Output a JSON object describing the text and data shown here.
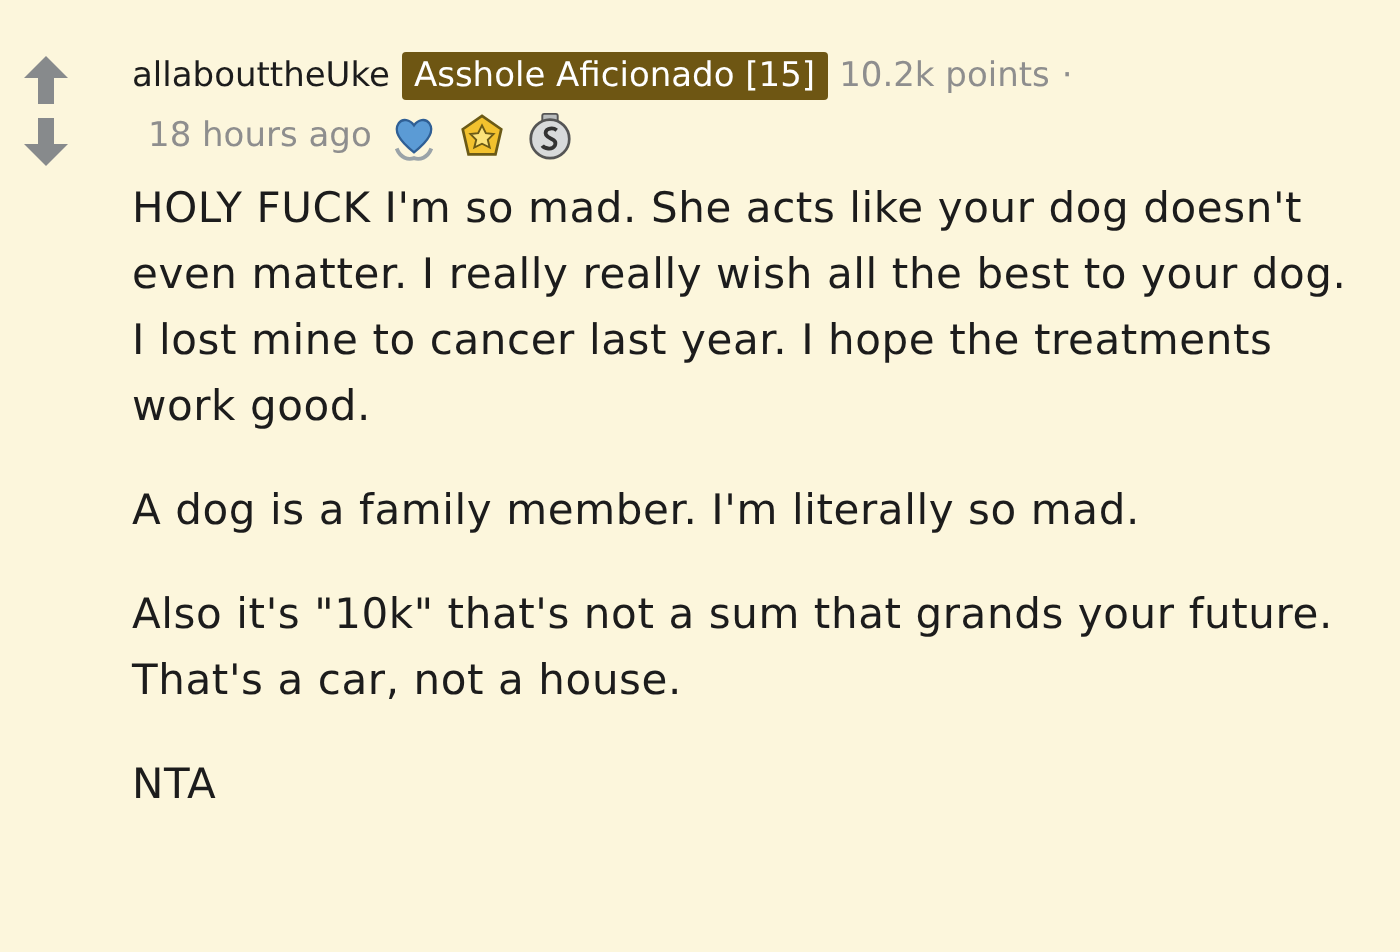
{
  "comment": {
    "author": "allabouttheUke",
    "flair": "Asshole Aficionado [15]",
    "points": "10.2k points",
    "separator": "·",
    "time": "18 hours ago",
    "awards": [
      {
        "kind": "heart"
      },
      {
        "kind": "gold"
      },
      {
        "kind": "silver"
      }
    ],
    "paragraphs": [
      "HOLY FUCK I'm so mad. She acts like your dog doesn't even matter. I really really wish all the best to your dog. I lost mine to cancer last year. I hope the treatments work good.",
      "A dog is a family member. I'm literally so mad.",
      "Also it's \"10k\" that's not a sum that grands your future. That's a car, not a house.",
      "NTA"
    ]
  }
}
